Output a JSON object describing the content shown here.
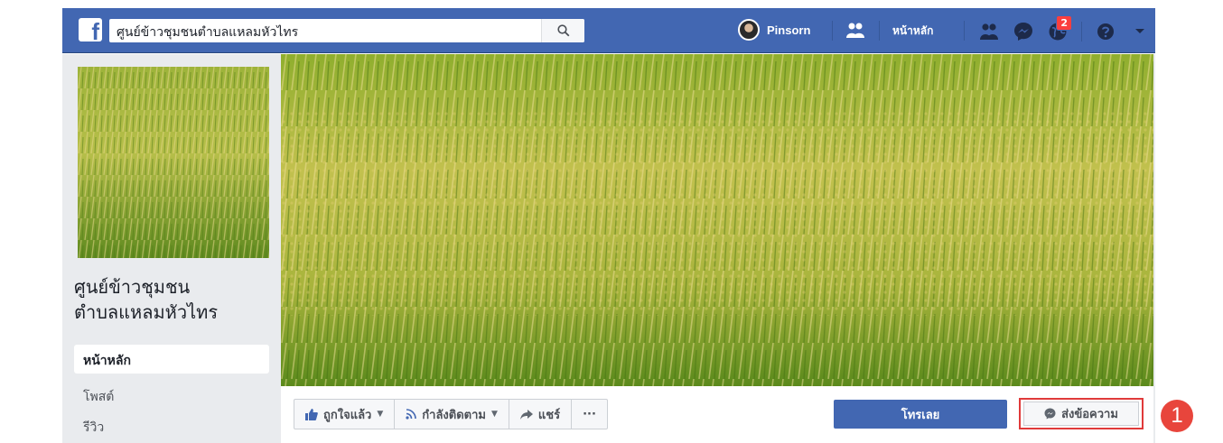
{
  "topbar": {
    "logo_letter": "f",
    "search_value": "ศูนย์ข้าวชุมชนตำบลแหลมหัวไทร",
    "profile_name": "Pinsorn",
    "home_label": "หน้าหลัก",
    "notification_count": "2",
    "icons": [
      "search-icon",
      "friends-icon",
      "friend-requests-icon",
      "messenger-icon",
      "notifications-globe-icon",
      "help-icon",
      "dropdown-caret-icon"
    ]
  },
  "sidebar": {
    "page_name_line1": "ศูนย์ข้าวชุมชน",
    "page_name_line2": "ตำบลแหลมหัวไทร",
    "nav_items": [
      {
        "label": "หน้าหลัก",
        "active": true
      },
      {
        "label": "โพสต์",
        "active": false
      },
      {
        "label": "รีวิว",
        "active": false
      }
    ]
  },
  "actions": {
    "liked_label": "ถูกใจแล้ว",
    "following_label": "กำลังติดตาม",
    "share_label": "แชร์",
    "more_label": "···",
    "call_label": "โทรเลย",
    "message_label": "ส่งข้อความ"
  },
  "annotation": {
    "step_number": "1"
  },
  "colors": {
    "brand_blue": "#4267b2",
    "annotation_red": "#e8453c",
    "page_bg": "#e9ebee"
  }
}
